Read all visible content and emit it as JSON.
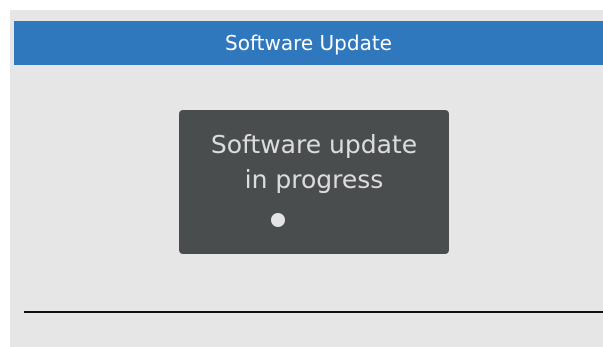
{
  "window": {
    "title": "Software Update"
  },
  "dialog": {
    "line1": "Software update",
    "line2": "in progress",
    "indicator_icon": "progress-dot-icon"
  },
  "colors": {
    "title_bar": "#2f78be",
    "background": "#e6e6e6",
    "dialog": "#4a4d4d",
    "text": "#dcdcdc"
  }
}
